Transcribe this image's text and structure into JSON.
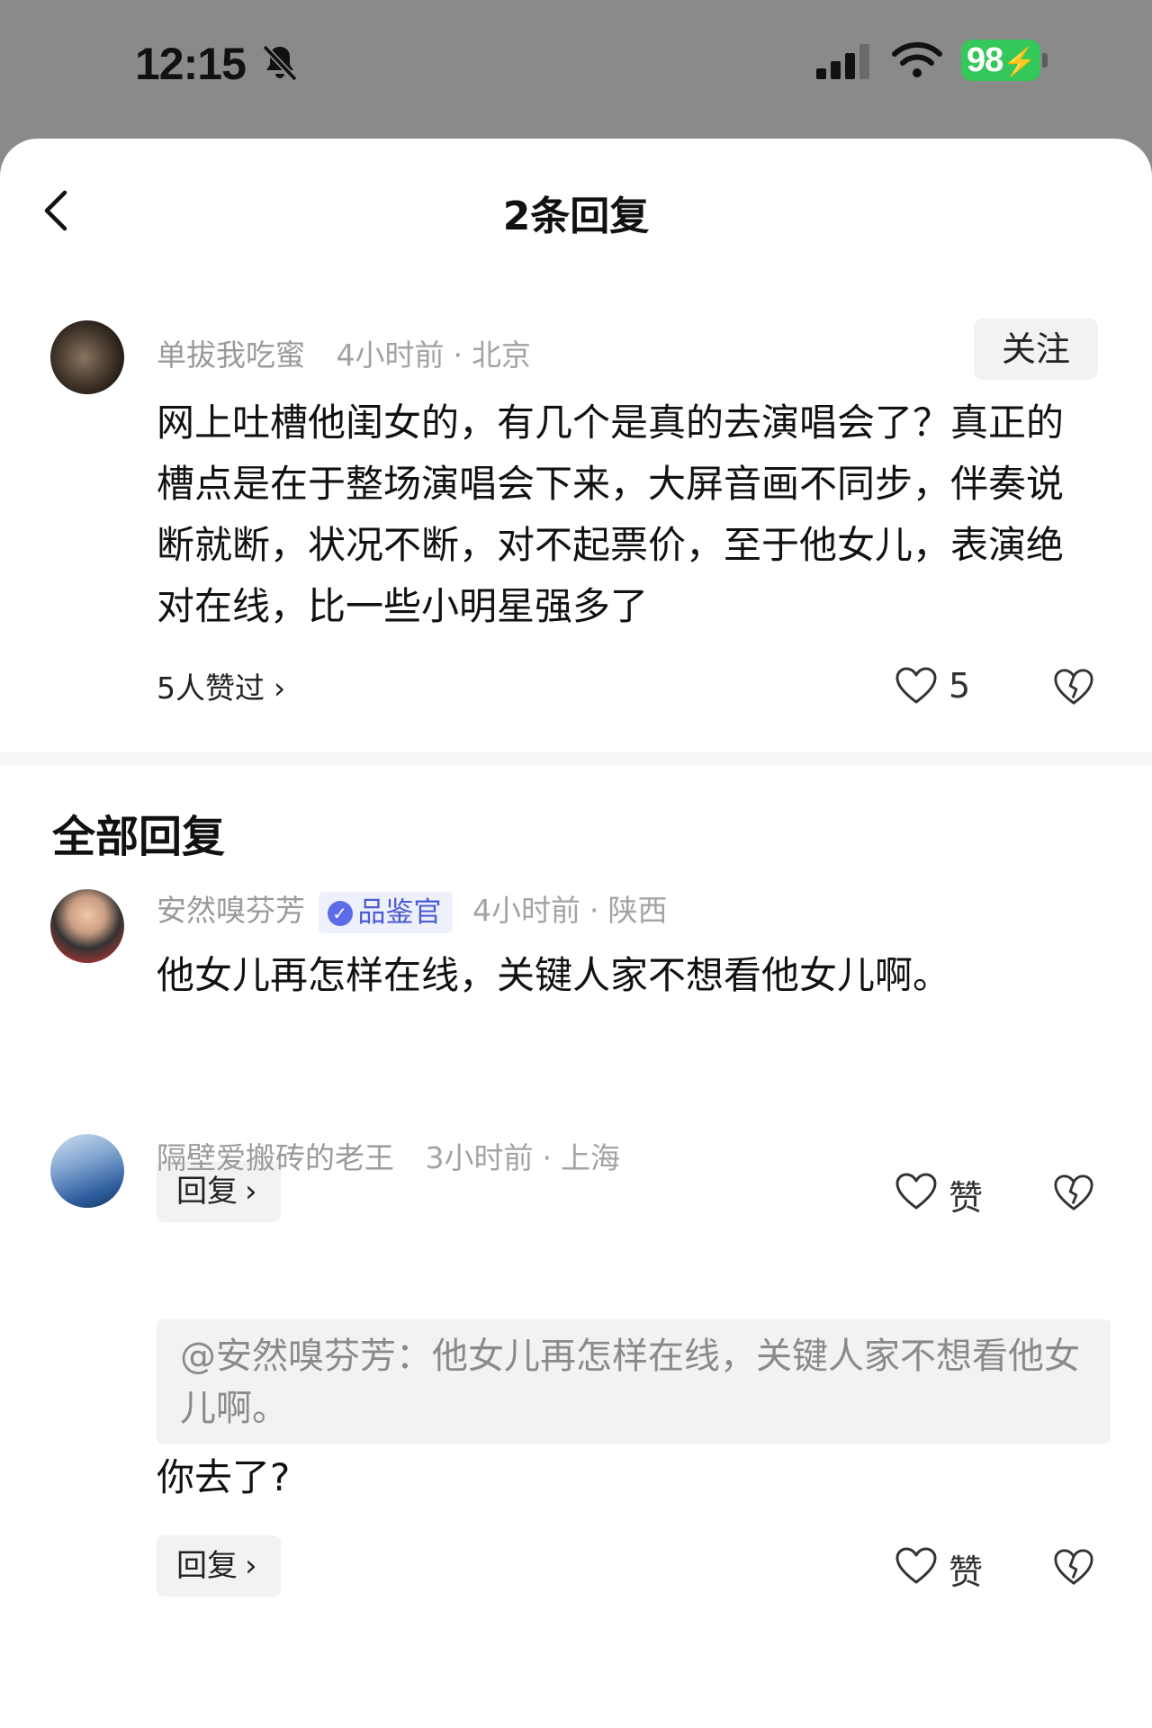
{
  "status_bar": {
    "time": "12:15",
    "battery": "98"
  },
  "header": {
    "title": "2条回复"
  },
  "main_comment": {
    "username": "单拔我吃蜜",
    "time": "4小时前",
    "location": "北京",
    "follow_label": "关注",
    "text": "网上吐槽他闺女的，有几个是真的去演唱会了？真正的槽点是在于整场演唱会下来，大屏音画不同步，伴奏说断就断，状况不断，对不起票价，至于他女儿，表演绝对在线，比一些小明星强多了",
    "likers_label": "5人赞过",
    "like_count": "5"
  },
  "section": {
    "title": "全部回复"
  },
  "replies": [
    {
      "username": "安然嗅芬芳",
      "badge": "品鉴官",
      "time": "4小时前",
      "location": "陕西",
      "text": "他女儿再怎样在线，关键人家不想看他女儿啊。",
      "reply_label": "回复",
      "like_label": "赞"
    },
    {
      "username": "隔壁爱搬砖的老王",
      "time": "3小时前",
      "location": "上海",
      "quote": "@安然嗅芬芳：他女儿再怎样在线，关键人家不想看他女儿啊。",
      "text": "你去了?",
      "reply_label": "回复",
      "like_label": "赞"
    }
  ],
  "icons": {
    "back": "chevron-left-icon",
    "like": "heart-outline-icon",
    "dislike": "broken-heart-icon",
    "badge": "verified-check-icon"
  },
  "colors": {
    "badge_text": "#4b5bd6",
    "battery": "#34c759",
    "meta": "#a3a3a3"
  }
}
